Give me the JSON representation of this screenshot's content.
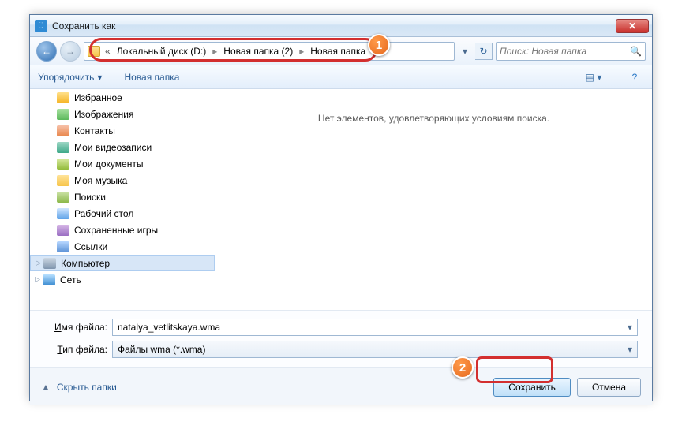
{
  "window": {
    "title": "Сохранить как"
  },
  "breadcrumb": {
    "overflow_icon": "«",
    "items": [
      "Локальный диск (D:)",
      "Новая папка (2)",
      "Новая папка"
    ]
  },
  "search": {
    "placeholder": "Поиск: Новая папка"
  },
  "toolbar": {
    "organize": "Упорядочить",
    "new_folder": "Новая папка"
  },
  "tree": {
    "items": [
      {
        "label": "Избранное",
        "icon": "star"
      },
      {
        "label": "Изображения",
        "icon": "pics"
      },
      {
        "label": "Контакты",
        "icon": "contact"
      },
      {
        "label": "Мои видеозаписи",
        "icon": "video"
      },
      {
        "label": "Мои документы",
        "icon": "docs"
      },
      {
        "label": "Моя музыка",
        "icon": "music"
      },
      {
        "label": "Поиски",
        "icon": "search"
      },
      {
        "label": "Рабочий стол",
        "icon": "desktop"
      },
      {
        "label": "Сохраненные игры",
        "icon": "saved"
      },
      {
        "label": "Ссылки",
        "icon": "links"
      }
    ],
    "root": [
      {
        "label": "Компьютер",
        "icon": "comp",
        "selected": true
      },
      {
        "label": "Сеть",
        "icon": "net"
      }
    ]
  },
  "content": {
    "empty_msg": "Нет элементов, удовлетворяющих условиям поиска."
  },
  "file": {
    "name_label": "Имя файла:",
    "name_value": "natalya_vetlitskaya.wma",
    "type_label": "Тип файла:",
    "type_value": "Файлы wma (*.wma)"
  },
  "bottom": {
    "hide": "Скрыть папки",
    "save": "Сохранить",
    "cancel": "Отмена"
  },
  "markers": {
    "m1": "1",
    "m2": "2"
  }
}
